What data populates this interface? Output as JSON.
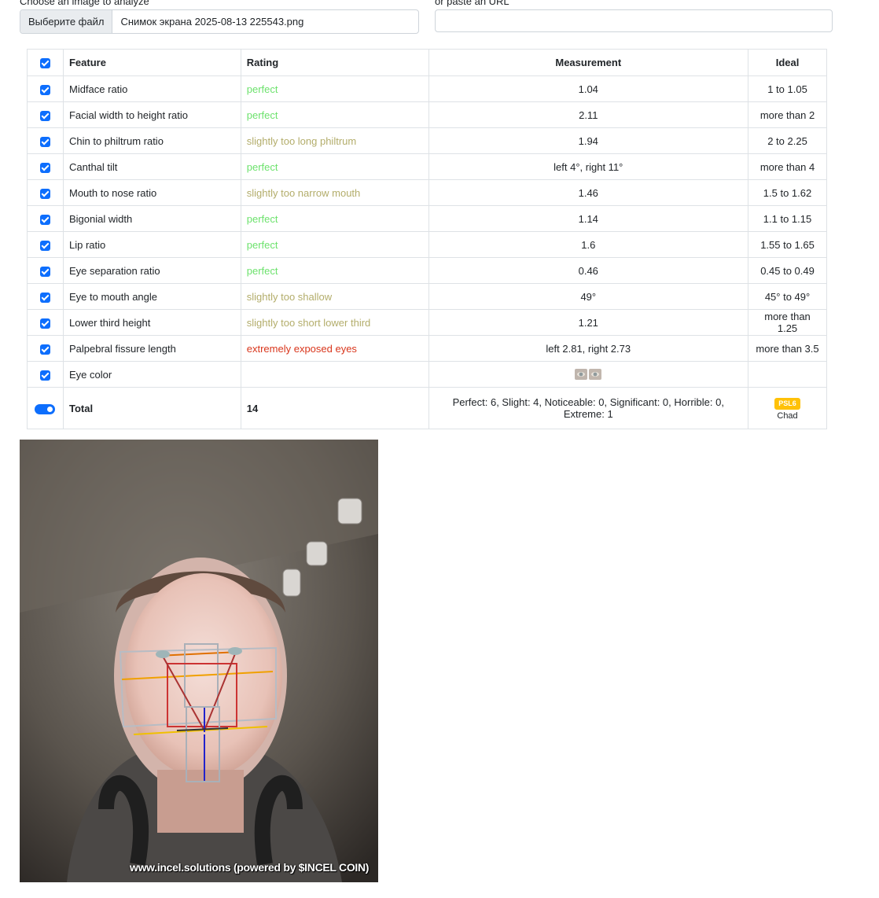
{
  "upload": {
    "label": "Choose an image to analyze",
    "button": "Выберите файл",
    "filename": "Снимок экрана 2025-08-13 225543.png"
  },
  "url": {
    "label": "or paste an URL",
    "value": "",
    "placeholder": ""
  },
  "table": {
    "headers": {
      "feature": "Feature",
      "rating": "Rating",
      "measurement": "Measurement",
      "ideal": "Ideal"
    },
    "rows": [
      {
        "feature": "Midface ratio",
        "rating": "perfect",
        "rating_level": "perfect",
        "measurement": "1.04",
        "ideal": "1 to 1.05"
      },
      {
        "feature": "Facial width to height ratio",
        "rating": "perfect",
        "rating_level": "perfect",
        "measurement": "2.11",
        "ideal": "more than 2"
      },
      {
        "feature": "Chin to philtrum ratio",
        "rating": "slightly too long philtrum",
        "rating_level": "slight",
        "measurement": "1.94",
        "ideal": "2 to 2.25"
      },
      {
        "feature": "Canthal tilt",
        "rating": "perfect",
        "rating_level": "perfect",
        "measurement": "left 4°, right 11°",
        "ideal": "more than 4"
      },
      {
        "feature": "Mouth to nose ratio",
        "rating": "slightly too narrow mouth",
        "rating_level": "slight",
        "measurement": "1.46",
        "ideal": "1.5 to 1.62"
      },
      {
        "feature": "Bigonial width",
        "rating": "perfect",
        "rating_level": "perfect",
        "measurement": "1.14",
        "ideal": "1.1 to 1.15"
      },
      {
        "feature": "Lip ratio",
        "rating": "perfect",
        "rating_level": "perfect",
        "measurement": "1.6",
        "ideal": "1.55 to 1.65"
      },
      {
        "feature": "Eye separation ratio",
        "rating": "perfect",
        "rating_level": "perfect",
        "measurement": "0.46",
        "ideal": "0.45 to 0.49"
      },
      {
        "feature": "Eye to mouth angle",
        "rating": "slightly too shallow",
        "rating_level": "slight",
        "measurement": "49°",
        "ideal": "45° to 49°"
      },
      {
        "feature": "Lower third height",
        "rating": "slightly too short lower third",
        "rating_level": "slight",
        "measurement": "1.21",
        "ideal": "more than 1.25"
      },
      {
        "feature": "Palpebral fissure length",
        "rating": "extremely exposed eyes",
        "rating_level": "extreme",
        "measurement": "left 2.81, right 2.73",
        "ideal": "more than 3.5"
      }
    ],
    "eye_color": {
      "feature": "Eye color",
      "rating": "",
      "ideal": ""
    },
    "total": {
      "label": "Total",
      "score": "14",
      "summary": "Perfect: 6, Slight: 4, Noticeable: 0, Significant: 0, Horrible: 0, Extreme: 1",
      "badge": "PSL6",
      "tier": "Chad"
    }
  },
  "colors": {
    "perfect": "#6de26d",
    "slight": "#b3ad6b",
    "extreme": "#d9361c",
    "accent": "#0d6efd",
    "badge": "#ffc107"
  },
  "photo": {
    "watermark": "www.incel.solutions (powered by $INCEL COIN)"
  }
}
